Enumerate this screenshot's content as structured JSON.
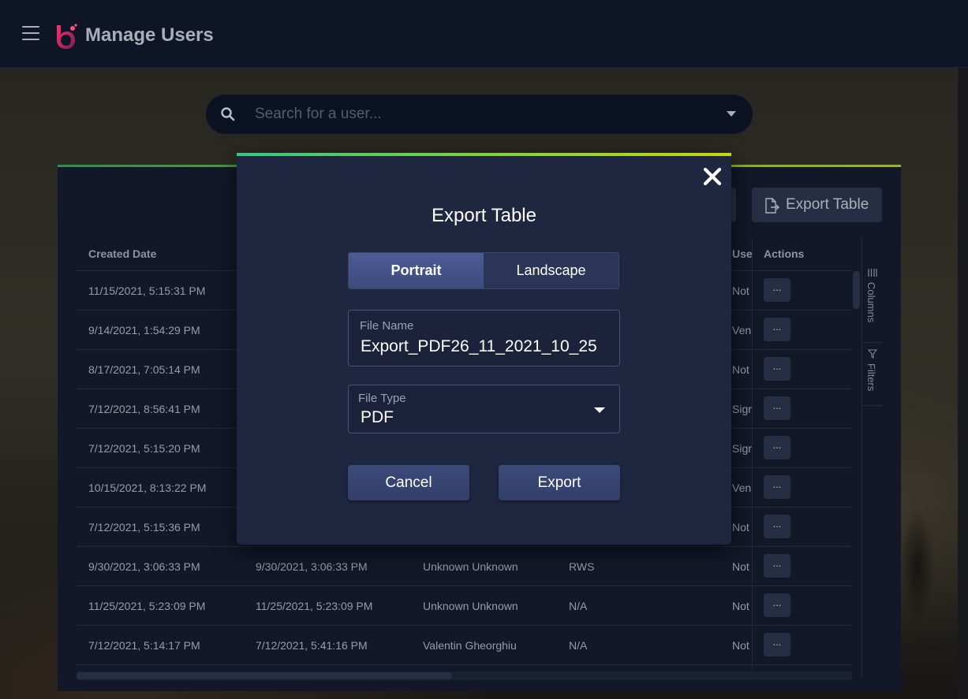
{
  "header": {
    "title": "Manage Users"
  },
  "search": {
    "placeholder": "Search for a user..."
  },
  "toolbar": {
    "export_table_label": "Export Table"
  },
  "table": {
    "columns": [
      "Created Date",
      "",
      "",
      "",
      "Use",
      "Actions"
    ],
    "rows": [
      {
        "created": "11/15/2021, 5:15:31 PM",
        "modified": "",
        "name": "",
        "company": "",
        "status": "Not",
        "action": "..."
      },
      {
        "created": "9/14/2021, 1:54:29 PM",
        "modified": "",
        "name": "",
        "company": "",
        "status": "Ven",
        "action": "..."
      },
      {
        "created": "8/17/2021, 7:05:14 PM",
        "modified": "",
        "name": "",
        "company": "",
        "status": "Not",
        "action": "..."
      },
      {
        "created": "7/12/2021, 8:56:41 PM",
        "modified": "",
        "name": "",
        "company": "",
        "status": "Sigr",
        "action": "..."
      },
      {
        "created": "7/12/2021, 5:15:20 PM",
        "modified": "",
        "name": "",
        "company": "",
        "status": "Sigr",
        "action": "..."
      },
      {
        "created": "10/15/2021, 8:13:22 PM",
        "modified": "",
        "name": "",
        "company": "",
        "status": "Ven",
        "action": "..."
      },
      {
        "created": "7/12/2021, 5:15:36 PM",
        "modified": "",
        "name": "",
        "company": "",
        "status": "Not",
        "action": "..."
      },
      {
        "created": "9/30/2021, 3:06:33 PM",
        "modified": "9/30/2021, 3:06:33 PM",
        "name": "Unknown Unknown",
        "company": "RWS",
        "status": "Not",
        "action": "..."
      },
      {
        "created": "11/25/2021, 5:23:09 PM",
        "modified": "11/25/2021, 5:23:09 PM",
        "name": "Unknown Unknown",
        "company": "N/A",
        "status": "Not",
        "action": "..."
      },
      {
        "created": "7/12/2021, 5:14:17 PM",
        "modified": "7/12/2021, 5:41:16 PM",
        "name": "Valentin Gheorghiu",
        "company": "N/A",
        "status": "Not",
        "action": "..."
      }
    ]
  },
  "side_panel": {
    "columns_label": "Columns",
    "filters_label": "Filters"
  },
  "modal": {
    "title": "Export Table",
    "orientation": {
      "portrait": "Portrait",
      "landscape": "Landscape",
      "selected": "Portrait"
    },
    "file_name": {
      "label": "File Name",
      "value": "Export_PDF26_11_2021_10_25"
    },
    "file_type": {
      "label": "File Type",
      "value": "PDF"
    },
    "cancel_label": "Cancel",
    "export_label": "Export"
  },
  "colors": {
    "header_bg": "#0e1526",
    "panel_bg": "#151b2d",
    "modal_bg": "#1f2740",
    "accent_green": "#34c786",
    "accent_yellow": "#c5d614",
    "button_bg": "#3c4a79"
  },
  "icons": {
    "menu": "hamburger-icon",
    "logo": "logo-icon",
    "search": "search-icon",
    "dropdown": "chevron-down-icon",
    "close": "close-icon",
    "export": "export-file-icon",
    "columns": "columns-icon",
    "filters": "filter-icon"
  }
}
